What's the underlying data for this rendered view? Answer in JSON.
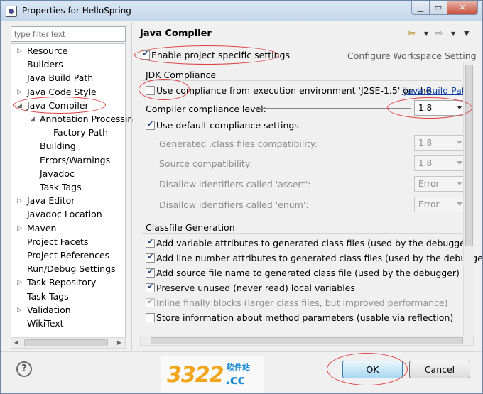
{
  "window": {
    "title": "Properties for HelloSpring"
  },
  "filter": {
    "placeholder": "type filter text"
  },
  "tree": [
    {
      "label": "Resource",
      "twisty": "▷",
      "indent": 0
    },
    {
      "label": "Builders",
      "twisty": "",
      "indent": 0
    },
    {
      "label": "Java Build Path",
      "twisty": "",
      "indent": 0
    },
    {
      "label": "Java Code Style",
      "twisty": "▷",
      "indent": 0
    },
    {
      "label": "Java Compiler",
      "twisty": "◢",
      "indent": 0
    },
    {
      "label": "Annotation Processin",
      "twisty": "◢",
      "indent": 1
    },
    {
      "label": "Factory Path",
      "twisty": "",
      "indent": 2
    },
    {
      "label": "Building",
      "twisty": "",
      "indent": 1
    },
    {
      "label": "Errors/Warnings",
      "twisty": "",
      "indent": 1
    },
    {
      "label": "Javadoc",
      "twisty": "",
      "indent": 1
    },
    {
      "label": "Task Tags",
      "twisty": "",
      "indent": 1
    },
    {
      "label": "Java Editor",
      "twisty": "▷",
      "indent": 0
    },
    {
      "label": "Javadoc Location",
      "twisty": "",
      "indent": 0
    },
    {
      "label": "Maven",
      "twisty": "▷",
      "indent": 0
    },
    {
      "label": "Project Facets",
      "twisty": "",
      "indent": 0
    },
    {
      "label": "Project References",
      "twisty": "",
      "indent": 0
    },
    {
      "label": "Run/Debug Settings",
      "twisty": "",
      "indent": 0
    },
    {
      "label": "Task Repository",
      "twisty": "▷",
      "indent": 0
    },
    {
      "label": "Task Tags",
      "twisty": "",
      "indent": 0
    },
    {
      "label": "Validation",
      "twisty": "▷",
      "indent": 0
    },
    {
      "label": "WikiText",
      "twisty": "",
      "indent": 0
    }
  ],
  "page": {
    "title": "Java Compiler",
    "enable_specific": "Enable project specific settings",
    "enable_specific_checked": true,
    "configure_link": "Configure Workspace Setting",
    "jdk": {
      "group_title": "JDK Compliance",
      "use_ee_label": "Use compliance from execution environment 'J2SE-1.5' on the ",
      "use_ee_link": "'Java Build Path",
      "use_ee_checked": false,
      "level_label": "Compiler compliance level:",
      "level_value": "1.8",
      "default_label": "Use default compliance settings",
      "default_checked": true,
      "rows": [
        {
          "label": "Generated .class files compatibility:",
          "value": "1.8"
        },
        {
          "label": "Source compatibility:",
          "value": "1.8"
        },
        {
          "label": "Disallow identifiers called 'assert':",
          "value": "Error"
        },
        {
          "label": "Disallow identifiers called 'enum':",
          "value": "Error"
        }
      ]
    },
    "classfile": {
      "group_title": "Classfile Generation",
      "items": [
        {
          "label": "Add variable attributes to generated class files (used by the debugger)",
          "checked": true,
          "disabled": false
        },
        {
          "label": "Add line number attributes to generated class files (used by the debugger)",
          "checked": true,
          "disabled": false
        },
        {
          "label": "Add source file name to generated class file (used by the debugger)",
          "checked": true,
          "disabled": false
        },
        {
          "label": "Preserve unused (never read) local variables",
          "checked": true,
          "disabled": false
        },
        {
          "label": "Inline finally blocks (larger class files, but improved performance)",
          "checked": true,
          "disabled": true
        },
        {
          "label": "Store information about method parameters (usable via reflection)",
          "checked": false,
          "disabled": false
        }
      ]
    }
  },
  "buttons": {
    "help": "?",
    "ok": "OK",
    "cancel": "Cancel"
  },
  "watermark": {
    "number": "3322",
    "site": "软件站",
    "domain": ".cc"
  }
}
